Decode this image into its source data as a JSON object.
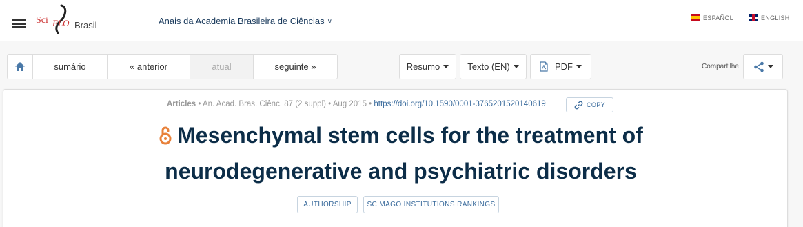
{
  "header": {
    "logo": {
      "text_sci": "Sci",
      "text_elo": "ELO",
      "country": "Brasil"
    },
    "journal_name": "Anais da Academia Brasileira de Ciências",
    "languages": [
      {
        "label": "ESPAÑOL",
        "flag": "es-flag-icon"
      },
      {
        "label": "ENGLISH",
        "flag": "uk-flag-icon"
      }
    ]
  },
  "toolbar": {
    "home_icon": "home-icon",
    "nav": {
      "sumario": "sumário",
      "anterior": "« anterior",
      "atual": "atual",
      "seguinte": "seguinte »"
    },
    "resumo": "Resumo",
    "texto": "Texto (EN)",
    "pdf": "PDF",
    "share_label": "Compartilhe"
  },
  "article": {
    "type": "Articles",
    "citation": " • An. Acad. Bras. Ciênc. 87 (2 suppl) • Aug 2015 • ",
    "doi": "https://doi.org/10.1590/0001-3765201520140619",
    "copy_label": "COPY",
    "title": "Mesenchymal stem cells for the treatment of neurodegenerative and psychiatric disorders",
    "tags": [
      "AUTHORSHIP",
      "SCIMAGO INSTITUTIONS RANKINGS"
    ]
  },
  "colors": {
    "title": "#0c2d48",
    "link": "#3a6b9c",
    "open_access": "#e8813a",
    "logo_red": "#c33"
  }
}
